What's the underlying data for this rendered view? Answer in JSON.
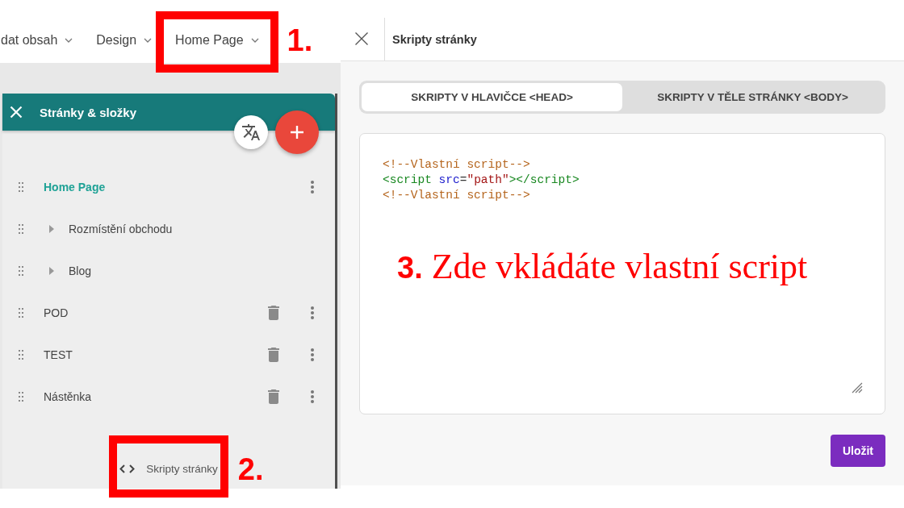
{
  "top_nav": {
    "items": [
      {
        "label": "dat obsah"
      },
      {
        "label": "Design"
      },
      {
        "label": "Home Page",
        "annotation": "1."
      }
    ]
  },
  "pages_panel": {
    "title": "Stránky & složky",
    "items": [
      {
        "label": "Home Page",
        "kind": "page",
        "selected": true,
        "deletable": false,
        "menu": true
      },
      {
        "label": "Rozmístění obchodu",
        "kind": "folder",
        "expanded": false,
        "selected": false,
        "deletable": false,
        "menu": false
      },
      {
        "label": "Blog",
        "kind": "folder",
        "expanded": false,
        "selected": false,
        "deletable": false,
        "menu": false
      },
      {
        "label": "POD",
        "kind": "page",
        "selected": false,
        "deletable": true,
        "menu": true
      },
      {
        "label": "TEST",
        "kind": "page",
        "selected": false,
        "deletable": true,
        "menu": true
      },
      {
        "label": "Nástěnka",
        "kind": "page",
        "selected": false,
        "deletable": true,
        "menu": true
      }
    ],
    "footer_link": {
      "label": "Skripty stránky",
      "annotation": "2."
    }
  },
  "scripts_panel": {
    "title": "Skripty stránky",
    "tabs": [
      {
        "label": "SKRIPTY V HLAVIČCE <HEAD>",
        "selected": true
      },
      {
        "label": "SKRIPTY V TĚLE STRÁNKY <BODY>",
        "selected": false
      }
    ],
    "code_editor": {
      "lines": [
        {
          "tokens": [
            {
              "text": "<!--Vlastní script-->",
              "kind": "comment"
            }
          ]
        },
        {
          "tokens": [
            {
              "text": "<script",
              "kind": "tag"
            },
            {
              "text": " src",
              "kind": "attribute"
            },
            {
              "text": "=",
              "kind": "punctuation"
            },
            {
              "text": "\"path\"",
              "kind": "string"
            },
            {
              "text": "></script>",
              "kind": "tag"
            }
          ]
        },
        {
          "tokens": [
            {
              "text": "<!--Vlastní script-->",
              "kind": "comment"
            }
          ]
        }
      ],
      "annotation": "**3.** Zde vkládáte vlastní script"
    },
    "save_button": "Uložit"
  }
}
